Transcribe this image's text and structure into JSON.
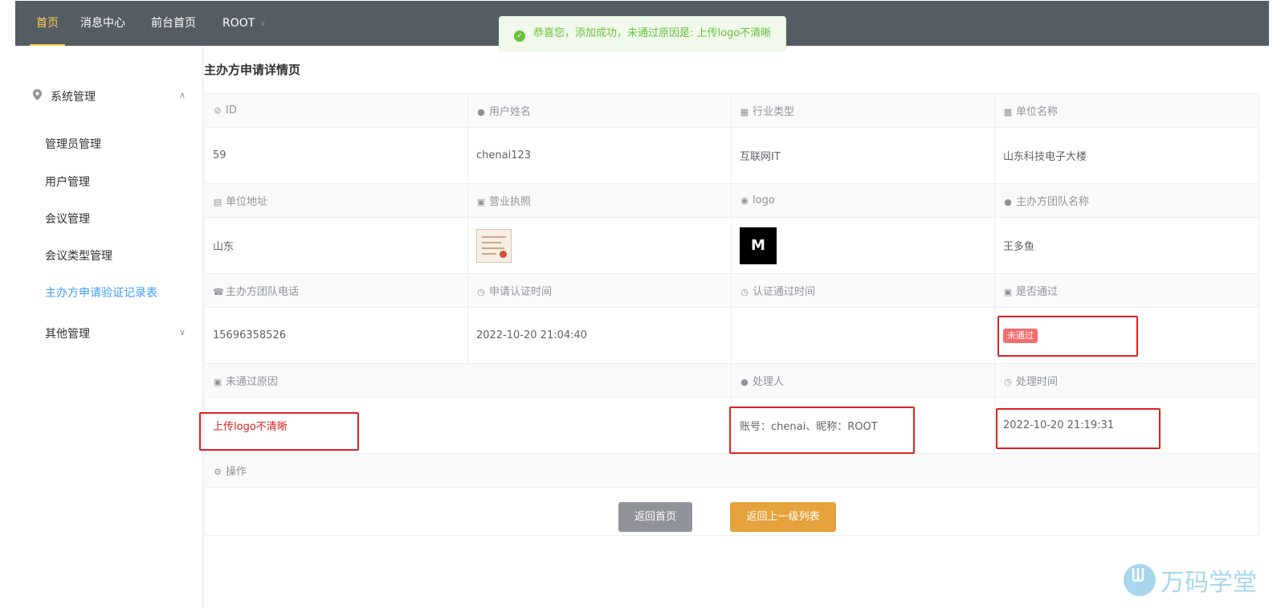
{
  "nav": {
    "items": [
      {
        "label": "首页"
      },
      {
        "label": "消息中心"
      },
      {
        "label": "前台首页"
      },
      {
        "label": "ROOT"
      }
    ],
    "active_color": "#ffd04b",
    "bg_color": "#545c64"
  },
  "toast": {
    "text": "恭喜您，添加成功，未通过原因是: 上传logo不清晰",
    "icon": "check-circle-icon",
    "color": "#67c23a"
  },
  "sidebar": {
    "group1": {
      "label": "系统管理",
      "icon": "location-pin-icon",
      "expanded": true
    },
    "items": [
      {
        "label": "管理员管理"
      },
      {
        "label": "用户管理"
      },
      {
        "label": "会议管理"
      },
      {
        "label": "会议类型管理"
      },
      {
        "label": "主办方申请验证记录表",
        "active": true
      }
    ],
    "group2": {
      "label": "其他管理",
      "expanded": false
    },
    "active_color": "#409eff"
  },
  "page": {
    "title": "主办方申请详情页"
  },
  "details": {
    "row1_labels": [
      {
        "label": "ID",
        "icon": "link-icon"
      },
      {
        "label": "用户姓名",
        "icon": "user-icon"
      },
      {
        "label": "行业类型",
        "icon": "grid-icon"
      },
      {
        "label": "单位名称",
        "icon": "chart-icon"
      }
    ],
    "row1_values": [
      "59",
      "chenai123",
      "互联网IT",
      "山东科技电子大楼"
    ],
    "row2_labels": [
      {
        "label": "单位地址",
        "icon": "building-icon"
      },
      {
        "label": "营业执照",
        "icon": "clipboard-icon"
      },
      {
        "label": "logo",
        "icon": "pin-icon"
      },
      {
        "label": "主办方团队名称",
        "icon": "user-icon"
      }
    ],
    "row2_values": {
      "address": "山东",
      "team_name": "王多鱼",
      "logo_letter": "M"
    },
    "row3_labels": [
      {
        "label": "主办方团队电话",
        "icon": "phone-icon"
      },
      {
        "label": "申请认证时间",
        "icon": "clock-icon"
      },
      {
        "label": "认证通过时间",
        "icon": "timer-icon"
      },
      {
        "label": "是否通过",
        "icon": "check-square-icon"
      }
    ],
    "row3_values": {
      "phone": "15696358526",
      "apply_time": "2022-10-20 21:04:40",
      "pass_time": "",
      "status": "未通过"
    },
    "row4_labels": [
      {
        "label": "未通过原因",
        "icon": "clipboard-icon"
      },
      {
        "label": "处理人",
        "icon": "user-icon"
      },
      {
        "label": "处理时间",
        "icon": "watch-icon"
      }
    ],
    "row4_values": {
      "reason": "上传logo不清晰",
      "handler": "账号：chenai、昵称：ROOT",
      "handle_time": "2022-10-20 21:19:31"
    },
    "ops_label": {
      "label": "操作",
      "icon": "gear-icon"
    }
  },
  "buttons": {
    "back_home": "返回首页",
    "back_list": "返回上一级列表"
  },
  "watermark": {
    "text": "万码学堂"
  },
  "colors": {
    "danger": "#f56c6c",
    "highlight_box": "#e02020",
    "warning": "#e6a23c",
    "info": "#909399"
  }
}
